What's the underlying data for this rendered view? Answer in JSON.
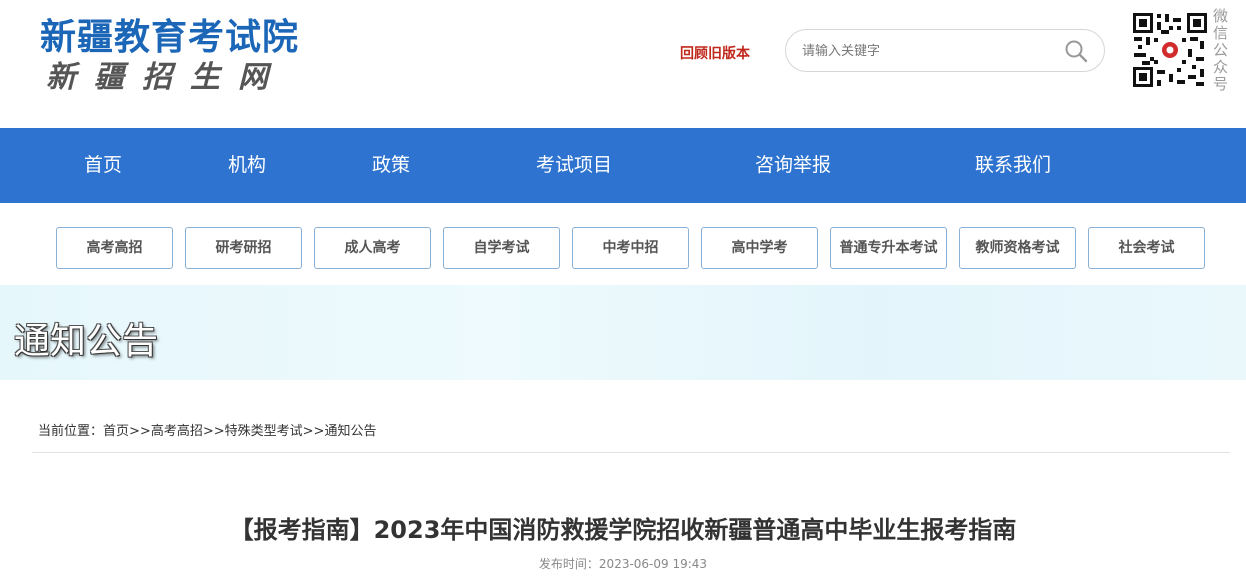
{
  "header": {
    "logo_title": "新疆教育考试院",
    "logo_subtitle": "新疆招生网",
    "old_version_link": "回顾旧版本",
    "search_placeholder": "请输入关键字",
    "qr_label": "微信公众号"
  },
  "main_nav": {
    "items": [
      {
        "label": "首页"
      },
      {
        "label": "机构"
      },
      {
        "label": "政策"
      },
      {
        "label": "考试项目"
      },
      {
        "label": "咨询举报"
      },
      {
        "label": "联系我们"
      }
    ]
  },
  "sub_nav": {
    "items": [
      {
        "label": "高考高招"
      },
      {
        "label": "研考研招"
      },
      {
        "label": "成人高考"
      },
      {
        "label": "自学考试"
      },
      {
        "label": "中考中招"
      },
      {
        "label": "高中学考"
      },
      {
        "label": "普通专升本考试"
      },
      {
        "label": "教师资格考试"
      },
      {
        "label": "社会考试"
      }
    ]
  },
  "banner": {
    "title": "通知公告"
  },
  "breadcrumb": {
    "prefix": "当前位置：",
    "items": [
      "首页",
      "高考高招",
      "特殊类型考试",
      "通知公告"
    ],
    "separator": ">>"
  },
  "article": {
    "title": "【报考指南】2023年中国消防救援学院招收新疆普通高中毕业生报考指南",
    "meta": "发布时间：2023-06-09 19:43"
  },
  "colors": {
    "brand_blue": "#1c66b8",
    "nav_bg": "#2d73cf",
    "old_version_red": "#c0281c"
  }
}
